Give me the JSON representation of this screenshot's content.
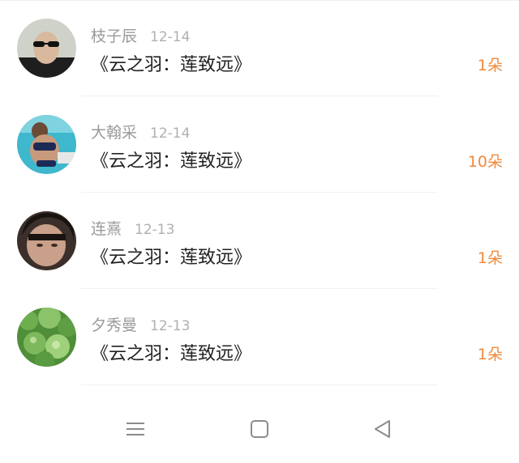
{
  "list": {
    "items": [
      {
        "name": "枝子辰",
        "date": "12-14",
        "gift": "《云之羽：莲致远》",
        "count": "1朵"
      },
      {
        "name": "大翰采",
        "date": "12-14",
        "gift": "《云之羽：莲致远》",
        "count": "10朵"
      },
      {
        "name": "连熹",
        "date": "12-13",
        "gift": "《云之羽：莲致远》",
        "count": "1朵"
      },
      {
        "name": "夕秀曼",
        "date": "12-13",
        "gift": "《云之羽：莲致远》",
        "count": "1朵"
      }
    ]
  },
  "colors": {
    "accent": "#f08a3c",
    "name_text": "#9a9a9a",
    "date_text": "#b0b0b0",
    "title_text": "#222222",
    "nav_icon": "#8c8c8c"
  },
  "navbar": {
    "icons": [
      "menu-icon",
      "home-square-icon",
      "back-triangle-icon"
    ]
  }
}
